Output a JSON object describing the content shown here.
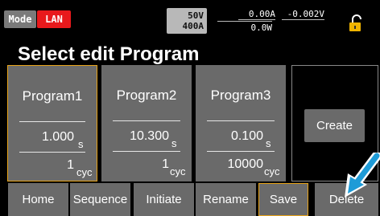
{
  "status": {
    "mode_label": "Mode",
    "interface_label": "LAN",
    "voltage_range": "50V",
    "current_range": "400A",
    "current_reading": "0.00A",
    "voltage_reading": "-0.002V",
    "power_reading": "0.0W"
  },
  "title": "Select edit Program",
  "programs": [
    {
      "name": "Program1",
      "time": "1.000",
      "time_unit": "s",
      "cycles": "1",
      "cycle_unit": "cyc",
      "selected": true
    },
    {
      "name": "Program2",
      "time": "10.300",
      "time_unit": "s",
      "cycles": "1",
      "cycle_unit": "cyc",
      "selected": false
    },
    {
      "name": "Program3",
      "time": "0.100",
      "time_unit": "s",
      "cycles": "10000",
      "cycle_unit": "cyc",
      "selected": false
    }
  ],
  "create_label": "Create",
  "bottom_buttons": {
    "home": "Home",
    "sequence": "Sequence",
    "initiate": "Initiate",
    "rename": "Rename",
    "save": "Save",
    "delete": "Delete"
  },
  "colors": {
    "accent_orange": "#e8a317",
    "lan_red": "#e8191c",
    "button_gray": "#6a6a6a",
    "arrow_blue": "#1e9bd7",
    "lock_yellow": "#f0b400"
  }
}
